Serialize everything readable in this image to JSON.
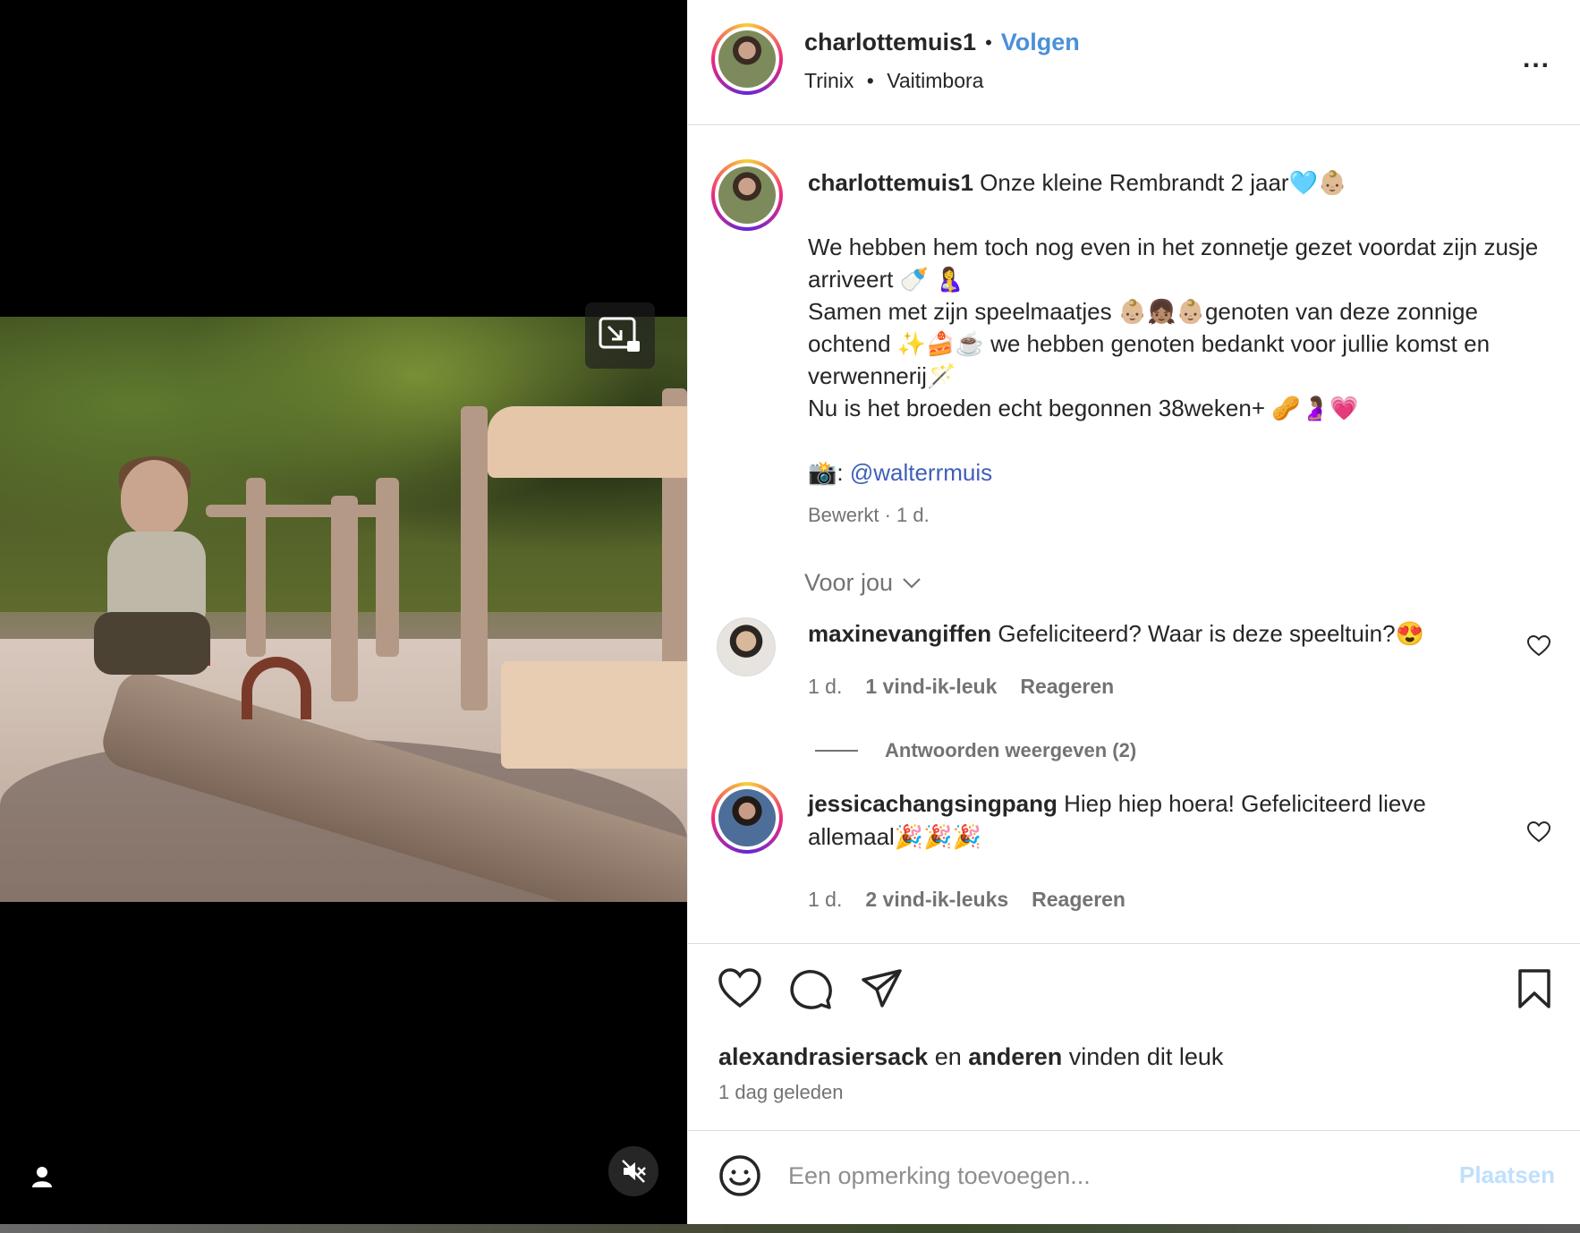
{
  "post": {
    "username": "charlottemuis1",
    "separator": "•",
    "follow_label": "Volgen",
    "audio": "Trinix",
    "audio_sep": "•",
    "artist": "Vaitimbora",
    "more_label": "..."
  },
  "caption": {
    "username": "charlottemuis1",
    "line1": " Onze kleine Rembrandt 2 jaar🩵👶🏼",
    "line2": "We hebben hem toch nog even in het zonnetje gezet voordat zijn zusje arriveert 🍼 🤱",
    "line3": "Samen met zijn speelmaatjes 👶🏼👧🏽👶🏼genoten van deze zonnige ochtend ✨🍰☕ we hebben genoten bedankt voor jullie komst en verwennerij🪄",
    "line4": "Nu is het broeden echt begonnen 38weken+ 🥜🤰🏽💗",
    "photo_prefix": "📸: ",
    "mention": "@walterrmuis",
    "meta": "Bewerkt · 1 d."
  },
  "voor_jou": "Voor jou",
  "comments": [
    {
      "username": "maxinevangiffen",
      "text": " Gefeliciteerd? Waar is deze speeltuin?😍",
      "time": "1 d.",
      "likes": "1 vind-ik-leuk",
      "reply": "Reageren"
    },
    {
      "username": "jessicachangsingpang",
      "text": " Hiep hiep hoera! Gefeliciteerd lieve allemaal🎉🎉🎉",
      "time": "1 d.",
      "likes": "2 vind-ik-leuks",
      "reply": "Reageren"
    }
  ],
  "replies_label": "Antwoorden weergeven (2)",
  "likes": {
    "user": "alexandrasiersack",
    "conj": " en ",
    "others": "anderen",
    "suffix": " vinden dit leuk"
  },
  "posted_ago": "1 dag geleden",
  "add_comment": {
    "placeholder": "Een opmerking toevoegen...",
    "post_label": "Plaatsen",
    "post_color": "#c0dffd"
  },
  "colors": {
    "accent": "#4a90d9",
    "mention": "#3f5fb8",
    "muted": "#737373"
  },
  "icons": [
    "picture-in-picture-icon",
    "mute-icon",
    "user-tag-icon",
    "heart-icon",
    "comment-icon",
    "share-icon",
    "bookmark-icon",
    "smile-icon",
    "chevron-down-icon",
    "more-icon"
  ]
}
